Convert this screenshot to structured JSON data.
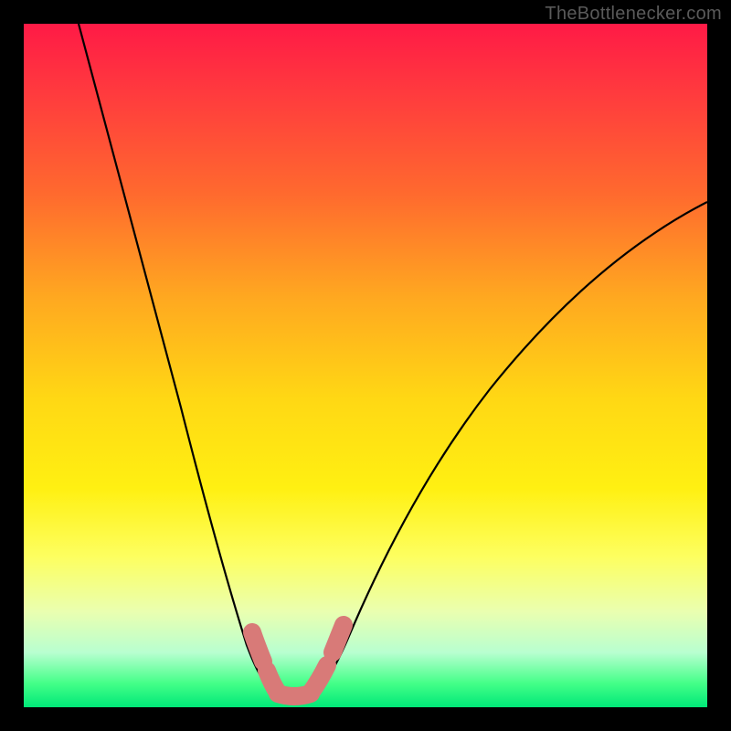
{
  "watermark": "TheBottlenecker.com",
  "chart_data": {
    "type": "line",
    "title": "",
    "xlabel": "",
    "ylabel": "",
    "xlim": [
      0,
      100
    ],
    "ylim": [
      0,
      100
    ],
    "series": [
      {
        "name": "left-curve",
        "x": [
          8,
          12,
          16,
          20,
          24,
          27,
          29.5,
          31.5,
          33.5,
          35,
          36.2,
          37.2
        ],
        "values": [
          100,
          86,
          72,
          58,
          44,
          30,
          18,
          10,
          5.5,
          3.2,
          2.3,
          2
        ]
      },
      {
        "name": "right-curve",
        "x": [
          42,
          43.5,
          45.5,
          48,
          52,
          57,
          63,
          70,
          78,
          87,
          96,
          100
        ],
        "values": [
          2,
          2.5,
          4,
          7,
          13,
          21,
          30,
          39,
          48,
          56,
          63,
          66
        ]
      }
    ],
    "annotations": {
      "valley_beads_color": "#d87a78",
      "background": "red-to-green vertical gradient"
    }
  },
  "colors": {
    "watermark": "#5a5a5a",
    "curve": "#000000",
    "beads": "#d87a78"
  }
}
